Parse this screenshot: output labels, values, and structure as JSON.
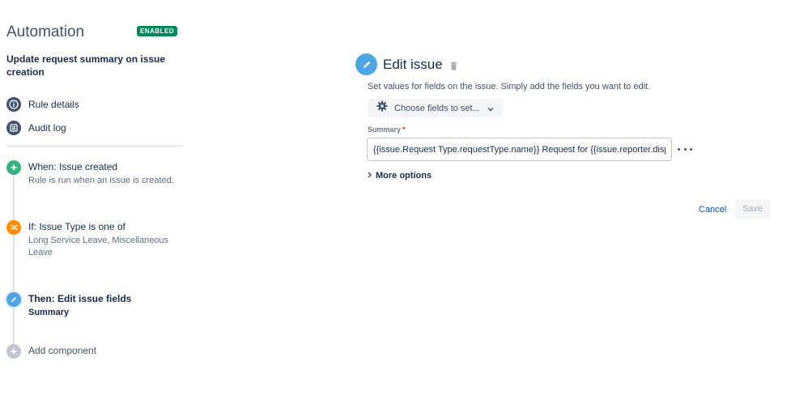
{
  "sidebar": {
    "app_title": "Automation",
    "status_badge": "ENABLED",
    "rule_name": "Update request summary on issue creation",
    "nav": [
      {
        "label": "Rule details",
        "icon": "info-icon"
      },
      {
        "label": "Audit log",
        "icon": "list-icon"
      }
    ],
    "steps": [
      {
        "title": "When: Issue created",
        "desc": "Rule is run when an issue is created.",
        "icon": "plus-icon",
        "color": "#36b37e"
      },
      {
        "title": "If: Issue Type is one of",
        "desc": "Long Service Leave, Miscellaneous Leave",
        "icon": "shuffle-icon",
        "color": "#ff8b00"
      },
      {
        "title": "Then: Edit issue fields",
        "desc": "Summary",
        "icon": "pencil-icon",
        "color": "#4da6e3"
      },
      {
        "title": "Add component",
        "desc": "",
        "icon": "plus-icon",
        "color": "#c1c7d0"
      }
    ]
  },
  "panel": {
    "title": "Edit issue",
    "description": "Set values for fields on the issue. Simply add the fields you want to edit.",
    "choose_fields_label": "Choose fields to set...",
    "summary_label": "Summary",
    "required_marker": "*",
    "summary_value": "{{issue.Request Type.requestType.name}} Request for {{issue.reporter.displayName}}",
    "more_options_label": "More options",
    "cancel_label": "Cancel",
    "save_label": "Save"
  },
  "colors": {
    "badge_green": "#00875a",
    "link_blue": "#0052cc",
    "icon_blue": "#4da6e3",
    "nav_icon_gray": "#42526e"
  }
}
